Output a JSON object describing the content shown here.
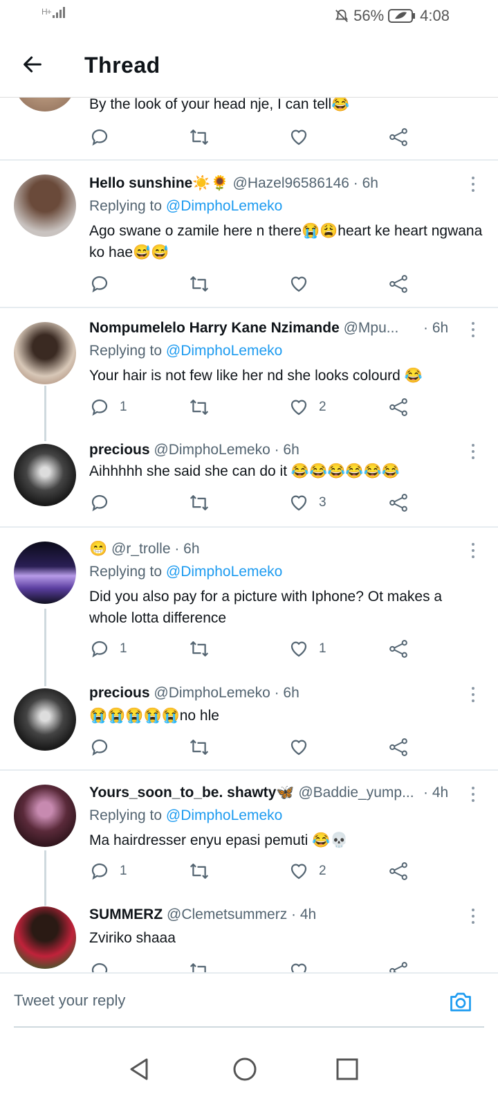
{
  "status_bar": {
    "network": "H+",
    "battery": "56%",
    "time": "4:08"
  },
  "header": {
    "title": "Thread"
  },
  "top_tweet": {
    "text": "By the look of your head nje, I can tell😂"
  },
  "tweets": [
    {
      "name": "Hello sunshine☀️🌻",
      "handle": "@Hazel96586146",
      "time": "· 6h",
      "replying_label": "Replying to",
      "mention": "@DimphoLemeko",
      "text": "Ago swane o zamile here n there😭😩heart ke heart ngwana ko hae😅😅",
      "replies": "",
      "likes": ""
    },
    {
      "name": "Nompumelelo Harry Kane Nzimande",
      "handle": "@Mpu...",
      "time": "· 6h",
      "replying_label": "Replying to",
      "mention": "@DimphoLemeko",
      "text": "Your hair is not few like her nd she looks colourd 😂",
      "replies": "1",
      "likes": "2"
    },
    {
      "name": "precious",
      "handle": "@DimphoLemeko",
      "time": "· 6h",
      "text": "Aihhhhh she said she can do it 😂😂😂😂😂😂",
      "replies": "",
      "likes": "3"
    },
    {
      "name": "😁",
      "handle": "@r_trolle",
      "time": "· 6h",
      "replying_label": "Replying to",
      "mention": "@DimphoLemeko",
      "text": "Did you also pay for a picture with Iphone? Ot makes a whole lotta difference",
      "replies": "1",
      "likes": "1"
    },
    {
      "name": "precious",
      "handle": "@DimphoLemeko",
      "time": "· 6h",
      "text": "😭😭😭😭😭no hle",
      "replies": "",
      "likes": ""
    },
    {
      "name": "Yours_soon_to_be. shawty🦋",
      "handle": "@Baddie_yump...",
      "time": "· 4h",
      "replying_label": "Replying to",
      "mention": "@DimphoLemeko",
      "text": "Ma hairdresser enyu epasi pemuti 😂💀",
      "replies": "1",
      "likes": "2"
    },
    {
      "name": "SUMMERZ",
      "handle": "@Clemetsummerz",
      "time": "· 4h",
      "text": "Zviriko shaaa",
      "replies": "",
      "likes": ""
    }
  ],
  "compose": {
    "placeholder": "Tweet your reply"
  },
  "colors": {
    "link": "#1d9bf0",
    "muted": "#536471",
    "divider": "#e6ecf0"
  },
  "icons": [
    "back-arrow-icon",
    "reply-icon",
    "retweet-icon",
    "like-icon",
    "share-icon",
    "more-icon",
    "camera-icon",
    "nav-back-icon",
    "nav-home-icon",
    "nav-recents-icon"
  ]
}
